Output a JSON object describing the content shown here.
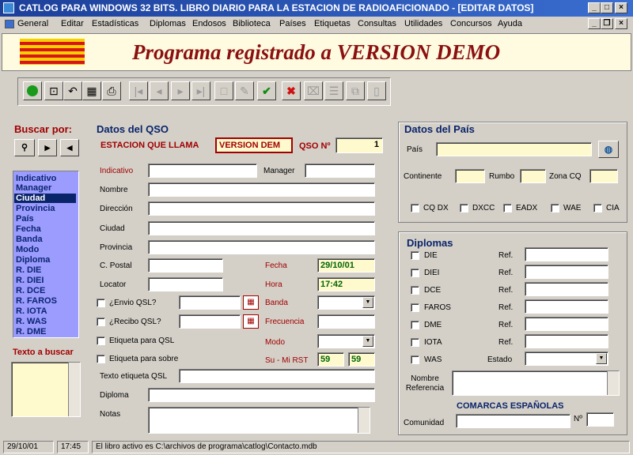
{
  "window": {
    "title": "CATLOG PARA WINDOWS 32 BITS. LIBRO DIARIO PARA LA ESTACION DE RADIOAFICIONADO - [EDITAR DATOS]"
  },
  "menu": [
    "General",
    "Editar",
    "Estadísticas",
    "Diplomas",
    "Endosos",
    "Biblioteca",
    "Países",
    "Etiquetas",
    "Consultas",
    "Utilidades",
    "Concursos",
    "Ayuda"
  ],
  "banner": {
    "text": "Programa registrado a VERSION DEMO"
  },
  "search": {
    "title": "Buscar por:",
    "items": [
      "Indicativo",
      "Manager",
      "Ciudad",
      "Provincia",
      "País",
      "Fecha",
      "Banda",
      "Modo",
      "Diploma",
      "R. DIE",
      "R. DIEI",
      "R. DCE",
      "R. FAROS",
      "R. IOTA",
      "R. WAS",
      "R. DME"
    ],
    "selected_index": 2,
    "text_label": "Texto a buscar"
  },
  "qso": {
    "title": "Datos del QSO",
    "station_label": "ESTACION QUE LLAMA",
    "station_value": "VERSION DEM",
    "qso_label": "QSO Nº",
    "qso_value": "1",
    "labels": {
      "indicativo": "Indicativo",
      "manager": "Manager",
      "nombre": "Nombre",
      "direccion": "Dirección",
      "ciudad": "Ciudad",
      "provincia": "Provincia",
      "cpostal": "C. Postal",
      "locator": "Locator",
      "envio_qsl": "¿Envio QSL?",
      "recibo_qsl": "¿Recibo QSL?",
      "etiqueta_qsl": "Etiqueta para QSL",
      "etiqueta_sobre": "Etiqueta para sobre",
      "texto_etiqueta": "Texto etiqueta QSL",
      "diploma": "Diploma",
      "notas": "Notas",
      "fecha": "Fecha",
      "hora": "Hora",
      "banda": "Banda",
      "frecuencia": "Frecuencia",
      "modo": "Modo",
      "rst": "Su - Mi  RST"
    },
    "fecha_value": "29/10/01",
    "hora_value": "17:42",
    "rst_su": "59",
    "rst_mi": "59"
  },
  "pais": {
    "title": "Datos del País",
    "pais_label": "País",
    "continente_label": "Continente",
    "rumbo_label": "Rumbo",
    "zona_label": "Zona CQ",
    "checks": [
      "CQ DX",
      "DXCC",
      "EADX",
      "WAE",
      "CIA"
    ]
  },
  "diplomas": {
    "title": "Diplomas",
    "items": [
      "DIE",
      "DIEI",
      "DCE",
      "FAROS",
      "DME",
      "IOTA",
      "WAS"
    ],
    "ref_label": "Ref.",
    "estado_label": "Estado",
    "nombre_ref_label": "Nombre Referencia",
    "comarcas_title": "COMARCAS ESPAÑOLAS",
    "comunidad_label": "Comunidad",
    "num_label": "Nº"
  },
  "status": {
    "date": "29/10/01",
    "time": "17:45",
    "message": "El libro activo es C:\\archivos de programa\\catlog\\Contacto.mdb"
  }
}
